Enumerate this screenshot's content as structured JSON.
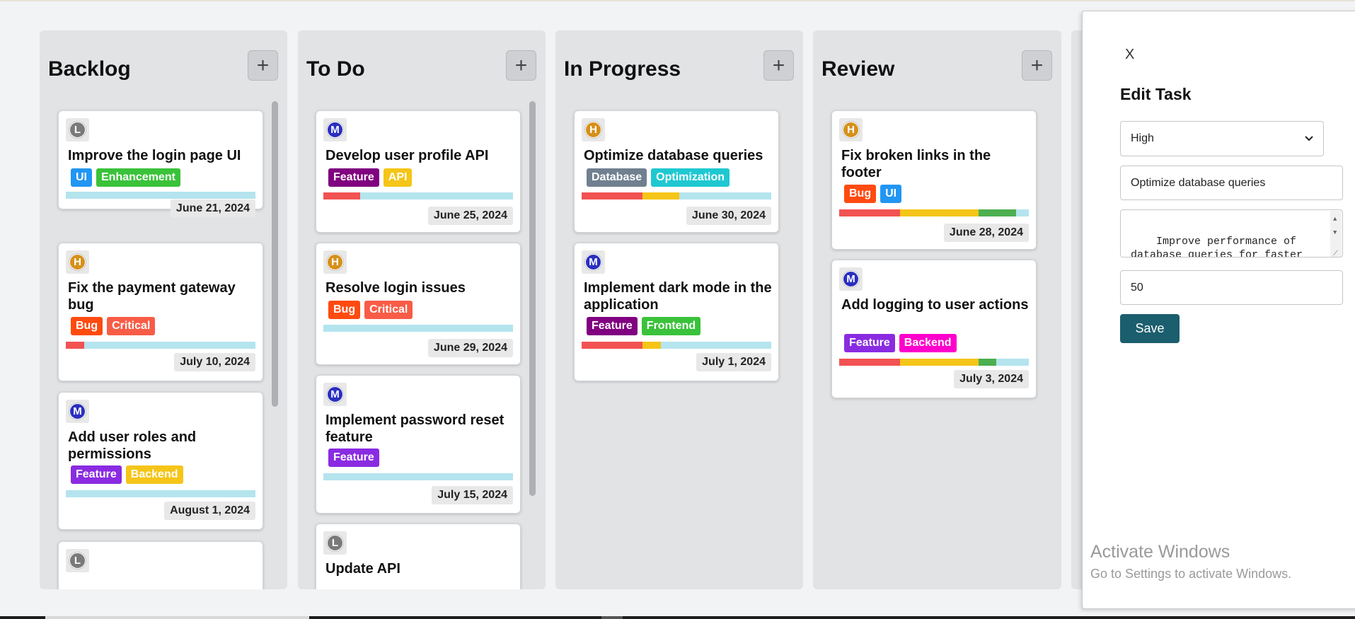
{
  "columns": [
    {
      "title": "Backlog",
      "add_label": "+"
    },
    {
      "title": "To Do",
      "add_label": "+"
    },
    {
      "title": "In Progress",
      "add_label": "+"
    },
    {
      "title": "Review",
      "add_label": "+"
    }
  ],
  "cards": {
    "backlog": [
      {
        "avatar": "L",
        "title": "Improve the login page UI",
        "tags": [
          "UI",
          "Enhancement"
        ],
        "date": "June 21, 2024"
      },
      {
        "avatar": "H",
        "title": "Fix the payment gateway bug",
        "tags": [
          "Bug",
          "Critical"
        ],
        "date": "July 10, 2024"
      },
      {
        "avatar": "M",
        "title": "Add user roles and permissions",
        "tags": [
          "Feature",
          "Backend"
        ],
        "date": "August 1, 2024"
      },
      {
        "avatar": "L",
        "title": "",
        "tags": [],
        "date": ""
      }
    ],
    "todo": [
      {
        "avatar": "M",
        "title": "Develop user profile API",
        "tags": [
          "Feature",
          "API"
        ],
        "date": "June 25, 2024"
      },
      {
        "avatar": "H",
        "title": "Resolve login issues",
        "tags": [
          "Bug",
          "Critical"
        ],
        "date": "June 29, 2024"
      },
      {
        "avatar": "M",
        "title": "Implement password reset feature",
        "tags": [
          "Feature"
        ],
        "date": "July 15, 2024"
      },
      {
        "avatar": "L",
        "title": "Update API",
        "tags": [],
        "date": ""
      }
    ],
    "inprogress": [
      {
        "avatar": "H",
        "title": "Optimize database queries",
        "tags": [
          "Database",
          "Optimization"
        ],
        "date": "June 30, 2024"
      },
      {
        "avatar": "M",
        "title": "Implement dark mode in the application",
        "tags": [
          "Feature",
          "Frontend"
        ],
        "date": "July 1, 2024"
      }
    ],
    "review": [
      {
        "avatar": "H",
        "title": "Fix broken links in the footer",
        "tags": [
          "Bug",
          "UI"
        ],
        "date": "June 28, 2024"
      },
      {
        "avatar": "M",
        "title": "Add logging to user actions",
        "tags": [
          "Feature",
          "Backend"
        ],
        "date": "July 3, 2024"
      }
    ]
  },
  "edit_panel": {
    "close_label": "X",
    "title": "Edit Task",
    "priority_value": "High",
    "title_value": "Optimize database queries",
    "description_value": "Improve performance of\ndatabase queries for faster\ndata retrieval",
    "progress_value": "50",
    "save_label": "Save"
  },
  "watermark": {
    "line1": "Activate Windows",
    "line2": "Go to Settings to activate Windows."
  },
  "colors": {
    "priority_low": "#7a7a7a",
    "priority_medium": "#2a2fbf",
    "priority_high": "#d6901a",
    "progress_track": "#b4e4ee",
    "progress_red": "#f25252",
    "progress_yellow": "#f5c518",
    "progress_green": "#4caf50",
    "save_button": "#1b5e6d"
  }
}
